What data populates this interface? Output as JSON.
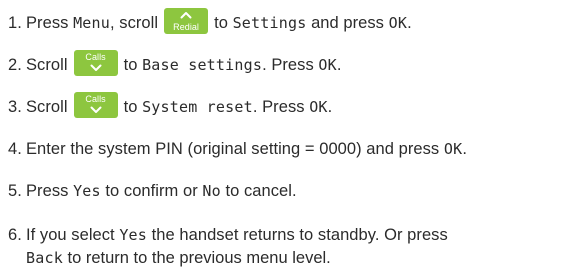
{
  "steps": [
    {
      "num": "1.",
      "parts": {
        "a": "Press ",
        "b": "Menu",
        "c": ", scroll",
        "key_label": "Redial",
        "d": "to ",
        "e": "Settings",
        "f": " and press ",
        "g": "OK",
        "h": "."
      }
    },
    {
      "num": "2.",
      "parts": {
        "a": "Scroll",
        "key_label": "Calls",
        "b": "to ",
        "c": "Base settings",
        "d": ". Press ",
        "e": "OK",
        "f": "."
      }
    },
    {
      "num": "3.",
      "parts": {
        "a": "Scroll",
        "key_label": "Calls",
        "b": "to ",
        "c": "System reset",
        "d": ". Press ",
        "e": "OK",
        "f": "."
      }
    },
    {
      "num": "4.",
      "parts": {
        "a": "Enter the system PIN (original setting = 0000) and press ",
        "b": "OK",
        "c": "."
      }
    },
    {
      "num": "5.",
      "parts": {
        "a": "Press ",
        "b": "Yes",
        "c": " to confirm or ",
        "d": "No",
        "e": " to cancel."
      }
    },
    {
      "num": "6.",
      "parts": {
        "a": "If you select ",
        "b": "Yes",
        "c": " the handset returns to standby. Or press",
        "line2_a": "Back",
        "line2_b": " to return to the previous menu level."
      }
    }
  ],
  "colors": {
    "key_green": "#8dc63f",
    "text": "#2b2b2b"
  },
  "icons": {
    "up": "chevron-up-icon",
    "down": "chevron-down-icon"
  }
}
